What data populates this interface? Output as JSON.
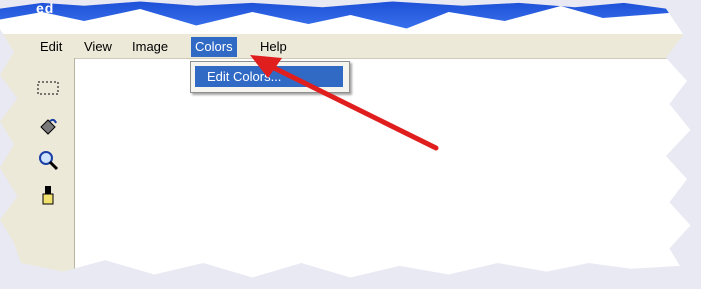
{
  "window": {
    "title": "ed"
  },
  "menubar": {
    "items": [
      {
        "label": "Edit"
      },
      {
        "label": "View"
      },
      {
        "label": "Image"
      },
      {
        "label": "Colors"
      },
      {
        "label": "Help"
      }
    ],
    "active": "Colors"
  },
  "dropdown": {
    "items": [
      {
        "label": "Edit Colors..."
      }
    ]
  },
  "toolbox": {
    "tools": [
      {
        "icon": "select-rect-icon"
      },
      {
        "icon": "fill-bucket-icon"
      },
      {
        "icon": "magnifier-icon"
      },
      {
        "icon": "brush-icon"
      }
    ]
  },
  "colors": {
    "accent": "#316ac5",
    "titlebar": "#1d4fd6",
    "arrow": "#e01e1e"
  }
}
